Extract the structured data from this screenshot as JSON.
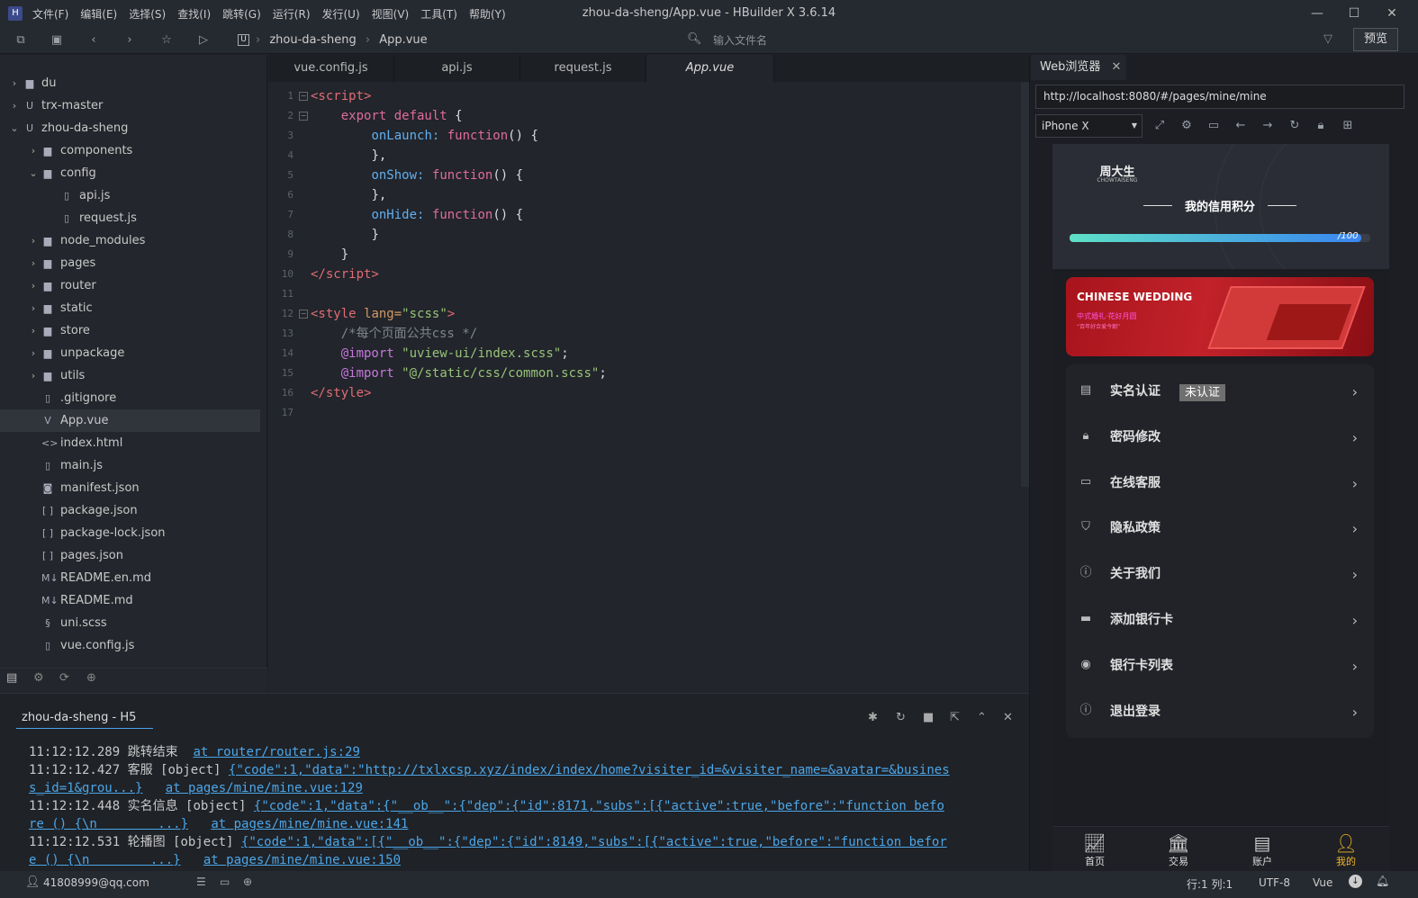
{
  "window": {
    "title": "zhou-da-sheng/App.vue - HBuilder X 3.6.14",
    "menu": [
      "文件(F)",
      "编辑(E)",
      "选择(S)",
      "查找(I)",
      "跳转(G)",
      "运行(R)",
      "发行(U)",
      "视图(V)",
      "工具(T)",
      "帮助(Y)"
    ]
  },
  "toolbar": {
    "breadcrumb": [
      "zhou-da-sheng",
      "App.vue"
    ],
    "file_search_placeholder": "输入文件名",
    "preview_label": "预览"
  },
  "explorer": {
    "items": [
      {
        "label": "du",
        "type": "folder",
        "state": "collapsed",
        "depth": 0
      },
      {
        "label": "trx-master",
        "type": "project",
        "state": "collapsed",
        "depth": 0
      },
      {
        "label": "zhou-da-sheng",
        "type": "project",
        "state": "expanded",
        "depth": 0
      },
      {
        "label": "components",
        "type": "folder",
        "state": "collapsed",
        "depth": 1
      },
      {
        "label": "config",
        "type": "folder",
        "state": "expanded",
        "depth": 1
      },
      {
        "label": "api.js",
        "type": "file",
        "depth": 2
      },
      {
        "label": "request.js",
        "type": "file",
        "depth": 2
      },
      {
        "label": "node_modules",
        "type": "folder",
        "state": "collapsed",
        "depth": 1
      },
      {
        "label": "pages",
        "type": "folder",
        "state": "collapsed",
        "depth": 1
      },
      {
        "label": "router",
        "type": "folder",
        "state": "collapsed",
        "depth": 1
      },
      {
        "label": "static",
        "type": "folder",
        "state": "collapsed",
        "depth": 1
      },
      {
        "label": "store",
        "type": "folder",
        "state": "collapsed",
        "depth": 1
      },
      {
        "label": "unpackage",
        "type": "folder",
        "state": "collapsed",
        "depth": 1
      },
      {
        "label": "utils",
        "type": "folder",
        "state": "collapsed",
        "depth": 1
      },
      {
        "label": ".gitignore",
        "type": "file",
        "depth": 1
      },
      {
        "label": "App.vue",
        "type": "vue",
        "depth": 1,
        "selected": true
      },
      {
        "label": "index.html",
        "type": "html",
        "depth": 1
      },
      {
        "label": "main.js",
        "type": "file",
        "depth": 1
      },
      {
        "label": "manifest.json",
        "type": "manifest",
        "depth": 1
      },
      {
        "label": "package.json",
        "type": "json",
        "depth": 1
      },
      {
        "label": "package-lock.json",
        "type": "json",
        "depth": 1
      },
      {
        "label": "pages.json",
        "type": "json",
        "depth": 1
      },
      {
        "label": "README.en.md",
        "type": "md",
        "depth": 1
      },
      {
        "label": "README.md",
        "type": "md",
        "depth": 1
      },
      {
        "label": "uni.scss",
        "type": "scss",
        "depth": 1
      },
      {
        "label": "vue.config.js",
        "type": "file",
        "depth": 1
      }
    ]
  },
  "editor": {
    "tabs": [
      "vue.config.js",
      "api.js",
      "request.js",
      "App.vue"
    ],
    "active_tab": "App.vue"
  },
  "console": {
    "title": "zhou-da-sheng - H5",
    "lines": [
      {
        "time": "11:12:12.289",
        "msg": "跳转结束",
        "link": "",
        "src": "at router/router.js:29"
      },
      {
        "time": "11:12:12.427",
        "msg": "客服 [object]",
        "link": "{\"code\":1,\"data\":\"http://txlxcsp.xyz/index/index/home?visiter_id=&visiter_name=&avatar=&busines",
        "link2": "s_id=1&grou...}",
        "src": "at pages/mine/mine.vue:129"
      },
      {
        "time": "11:12:12.448",
        "msg": "实名信息 [object]",
        "link": "{\"code\":1,\"data\":{\"__ob__\":{\"dep\":{\"id\":8171,\"subs\":[{\"active\":true,\"before\":\"function befo",
        "link2": "re () {\\n        ...}",
        "src": "at pages/mine/mine.vue:141"
      },
      {
        "time": "11:12:12.531",
        "msg": "轮播图 [object]",
        "link": "{\"code\":1,\"data\":[{\"__ob__\":{\"dep\":{\"id\":8149,\"subs\":[{\"active\":true,\"before\":\"function befor",
        "link2": "e () {\\n        ...}",
        "src": "at pages/mine/mine.vue:150"
      }
    ]
  },
  "browser": {
    "tab_title": "Web浏览器",
    "url": "http://localhost:8080/#/pages/mine/mine",
    "device": "iPhone X"
  },
  "phone": {
    "logo_cn": "周大生",
    "logo_en": "CHOWTAISENG",
    "credit_title": "我的信用积分",
    "credit_score": "/100",
    "credit_progress": 0.97,
    "banner_title": "CHINESE WEDDING",
    "banner_sub1": "中式婚礼·花好月圆",
    "banner_sub2": "“百年好合爱今朝”",
    "menu": [
      {
        "label": "实名认证",
        "badge": "未认证",
        "icon": "id-card-icon"
      },
      {
        "label": "密码修改",
        "icon": "lock-icon"
      },
      {
        "label": "在线客服",
        "icon": "chat-icon"
      },
      {
        "label": "隐私政策",
        "icon": "shield-icon"
      },
      {
        "label": "关于我们",
        "icon": "info-icon"
      },
      {
        "label": "添加银行卡",
        "icon": "card-icon"
      },
      {
        "label": "银行卡列表",
        "icon": "bank-icon"
      },
      {
        "label": "退出登录",
        "icon": "logout-icon"
      }
    ],
    "nav": [
      {
        "label": "首页"
      },
      {
        "label": "交易"
      },
      {
        "label": "账户"
      },
      {
        "label": "我的",
        "active": true
      }
    ],
    "accent": "#f0b429"
  },
  "statusbar": {
    "user": "41808999@qq.com",
    "position": "行:1 列:1",
    "encoding": "UTF-8",
    "language": "Vue"
  }
}
